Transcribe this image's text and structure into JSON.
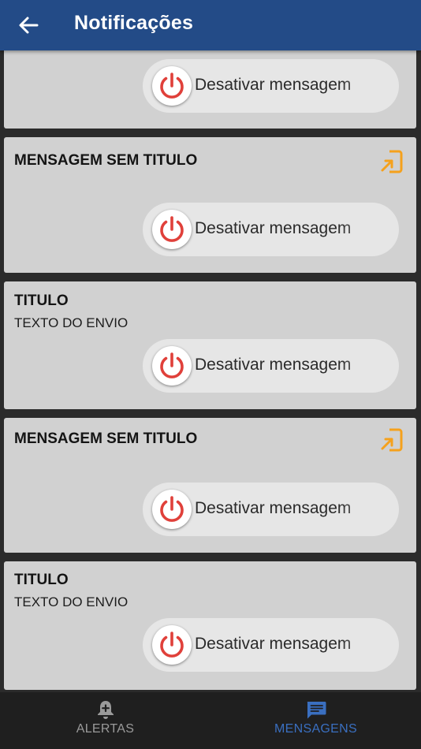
{
  "appbar": {
    "title": "Notificações",
    "back_icon": "arrow-back-icon",
    "background": "#234b87"
  },
  "cards": [
    {
      "title": "",
      "text": "",
      "has_attachment": false,
      "action_label": "Desativar mensagem"
    },
    {
      "title": "MENSAGEM SEM TITULO",
      "text": "",
      "has_attachment": true,
      "action_label": "Desativar mensagem"
    },
    {
      "title": "TITULO",
      "text": "TEXTO DO ENVIO",
      "has_attachment": false,
      "action_label": "Desativar mensagem"
    },
    {
      "title": "MENSAGEM SEM TITULO",
      "text": "",
      "has_attachment": true,
      "action_label": "Desativar mensagem"
    },
    {
      "title": "TITULO",
      "text": "TEXTO DO ENVIO",
      "has_attachment": false,
      "action_label": "Desativar mensagem"
    }
  ],
  "icons": {
    "power": "power-icon",
    "attachment": "open-in-icon"
  },
  "colors": {
    "power_red": "#e0403a",
    "attachment_orange": "#f5a11c",
    "nav_active": "#3a6fc0",
    "nav_inactive": "#9a9a9a"
  },
  "bottom_nav": {
    "items": [
      {
        "label": "ALERTAS",
        "icon": "bell-plus-icon",
        "active": false
      },
      {
        "label": "MENSAGENS",
        "icon": "message-icon",
        "active": true
      }
    ]
  }
}
